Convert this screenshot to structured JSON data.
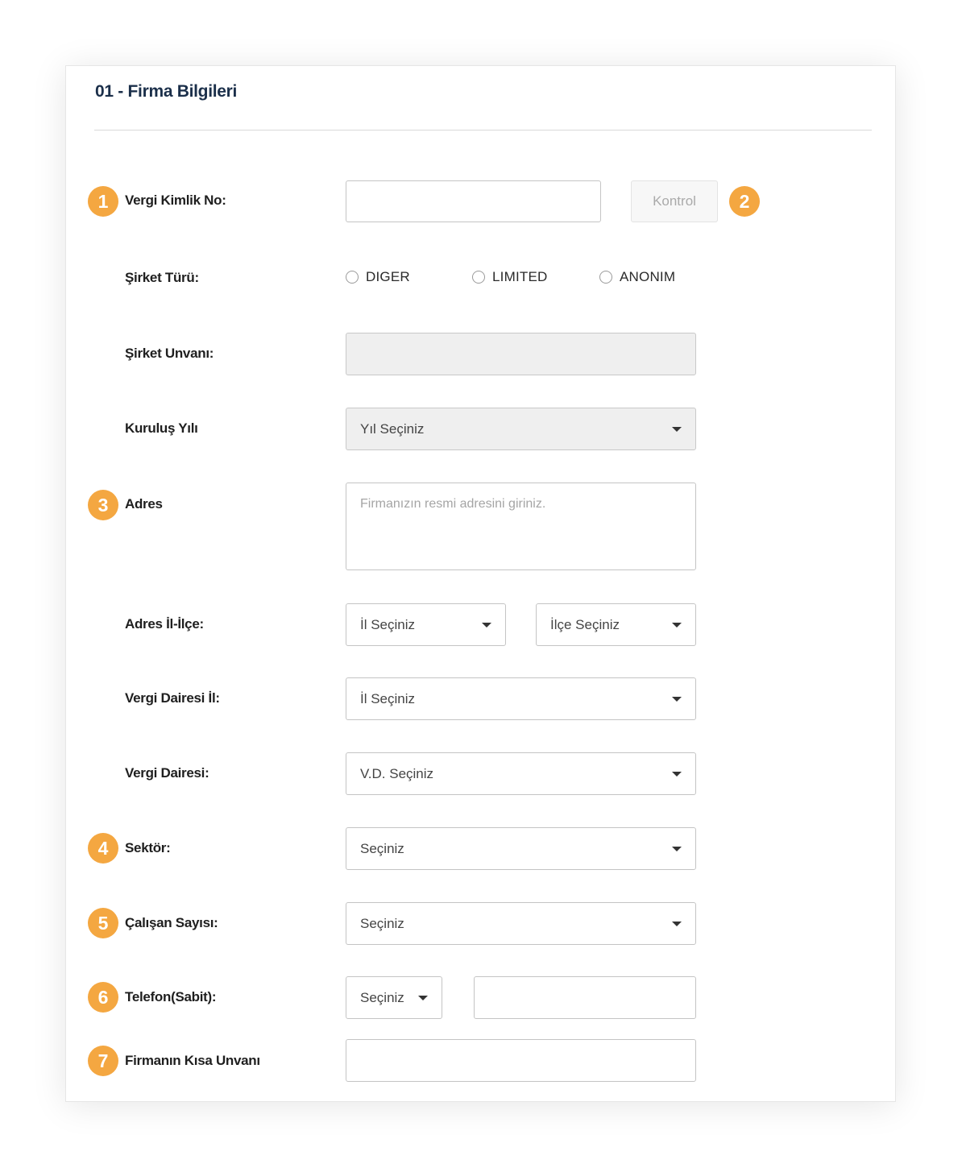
{
  "section": {
    "title": "01 - Firma Bilgileri"
  },
  "fields": {
    "vergi_kimlik": {
      "badge": "1",
      "label": "Vergi Kimlik No:",
      "value": ""
    },
    "kontrol": {
      "label": "Kontrol",
      "badge": "2"
    },
    "sirket_turu": {
      "label": "Şirket Türü:",
      "options": [
        "DIGER",
        "LIMITED",
        "ANONIM"
      ]
    },
    "sirket_unvani": {
      "label": "Şirket Unvanı:",
      "value": ""
    },
    "kurulus_yili": {
      "label": "Kuruluş Yılı",
      "selected": "Yıl Seçiniz"
    },
    "adres": {
      "badge": "3",
      "label": "Adres",
      "placeholder": "Firmanızın resmi adresini giriniz."
    },
    "adres_il_ilce": {
      "label": "Adres İl-İlçe:",
      "il_selected": "İl Seçiniz",
      "ilce_selected": "İlçe Seçiniz"
    },
    "vergi_dairesi_il": {
      "label": "Vergi Dairesi İl:",
      "selected": "İl Seçiniz"
    },
    "vergi_dairesi": {
      "label": "Vergi Dairesi:",
      "selected": "V.D. Seçiniz"
    },
    "sektor": {
      "badge": "4",
      "label": "Sektör:",
      "selected": "Seçiniz"
    },
    "calisan_sayisi": {
      "badge": "5",
      "label": "Çalışan Sayısı:",
      "selected": "Seçiniz"
    },
    "telefon": {
      "badge": "6",
      "label": "Telefon(Sabit):",
      "code_selected": "Seçiniz",
      "value": ""
    },
    "kisa_unvan": {
      "badge": "7",
      "label": "Firmanın Kısa Unvanı",
      "value": ""
    }
  },
  "colors": {
    "badge": "#f4a741",
    "title": "#1b2f4a",
    "disabled_field": "#efefef"
  }
}
